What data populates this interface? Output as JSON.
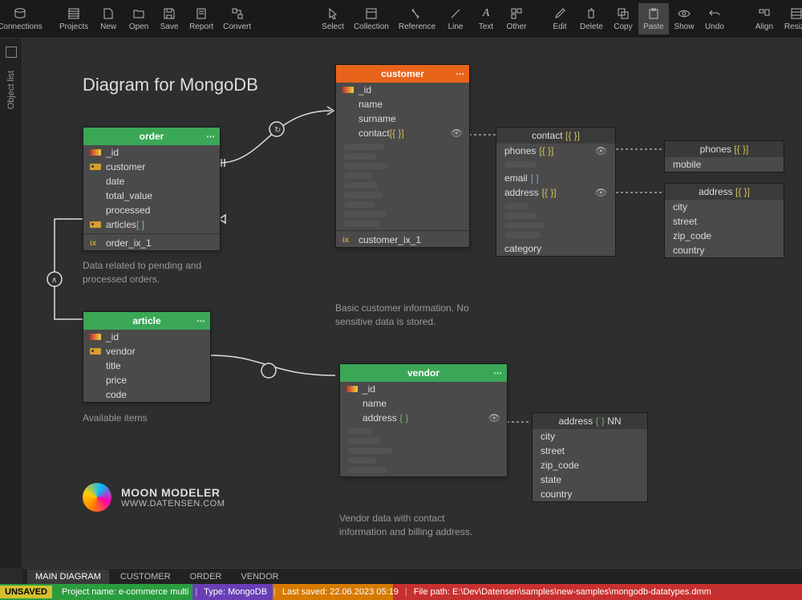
{
  "toolbar": {
    "connections": "Connections",
    "projects": "Projects",
    "new": "New",
    "open": "Open",
    "save": "Save",
    "report": "Report",
    "convert": "Convert",
    "select": "Select",
    "collection": "Collection",
    "reference": "Reference",
    "line": "Line",
    "text": "Text",
    "other": "Other",
    "edit": "Edit",
    "delete": "Delete",
    "copy": "Copy",
    "paste": "Paste",
    "show": "Show",
    "undo": "Undo",
    "align": "Align",
    "resize": "Resize"
  },
  "leftbar": {
    "object_list": "Object list"
  },
  "diagram": {
    "title": "Diagram for MongoDB"
  },
  "entities": {
    "order": {
      "title": "order",
      "fields": [
        "_id",
        "customer",
        "date",
        "total_value",
        "processed",
        "articles"
      ],
      "articles_brackets": "[ ]",
      "index": "order_ix_1",
      "caption": "Data related to pending and processed orders."
    },
    "article": {
      "title": "article",
      "fields": [
        "_id",
        "vendor",
        "title",
        "price",
        "code"
      ],
      "caption": "Available items"
    },
    "customer": {
      "title": "customer",
      "fields": [
        "_id",
        "name",
        "surname",
        "contact"
      ],
      "contact_brackets": "[{ }]",
      "index": "customer_ix_1",
      "caption": "Basic customer information. No sensitive data is stored."
    },
    "vendor": {
      "title": "vendor",
      "fields": [
        "_id",
        "name",
        "address"
      ],
      "address_brackets": "{ }",
      "caption": "Vendor data with contact information and billing address."
    }
  },
  "sub": {
    "contact": {
      "title": "contact",
      "title_brackets": "[{ }]",
      "rows": [
        {
          "name": "phones",
          "brackets": "[{ }]"
        },
        {
          "name": "email",
          "brackets": "[ ]"
        },
        {
          "name": "address",
          "brackets": "[{ }]"
        }
      ],
      "category": "category"
    },
    "phones": {
      "title": "phones",
      "title_brackets": "[{ }]",
      "rows": [
        "mobile"
      ]
    },
    "address": {
      "title": "address",
      "title_brackets": "[{ }]",
      "rows": [
        "city",
        "street",
        "zip_code",
        "country"
      ]
    },
    "vendor_address": {
      "title": "address",
      "title_brackets": "{ }",
      "nn": "NN",
      "rows": [
        "city",
        "street",
        "zip_code",
        "state",
        "country"
      ]
    }
  },
  "logo": {
    "name": "MOON MODELER",
    "site": "WWW.DATENSEN.COM"
  },
  "bottom_tabs": [
    "MAIN DIAGRAM",
    "CUSTOMER",
    "ORDER",
    "VENDOR"
  ],
  "status": {
    "unsaved": "UNSAVED",
    "project": "Project name: e-commerce multi",
    "type": "Type: MongoDB",
    "saved": "Last saved: 22.06.2023 05:19",
    "path": "File path: E:\\Dev\\Datensen\\samples\\new-samples\\mongodb-datatypes.dmm"
  }
}
